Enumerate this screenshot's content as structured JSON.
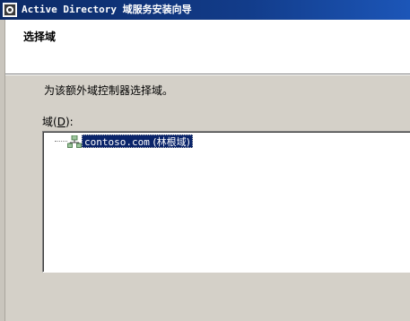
{
  "window": {
    "title": "Active Directory 域服务安装向导"
  },
  "header": {
    "title": "选择域"
  },
  "main": {
    "instruction": "为该额外域控制器选择域。",
    "domain_label_prefix": "域(",
    "domain_label_accel": "D",
    "domain_label_suffix": "):",
    "tree_items": [
      {
        "name": "contoso.com",
        "suffix": " (林根域)",
        "selected": true,
        "icon": "domain-tree-icon"
      }
    ]
  },
  "colors": {
    "title_bar": "#0c2a66",
    "selection": "#0a246a",
    "dialog_background": "#d4d0c8"
  }
}
